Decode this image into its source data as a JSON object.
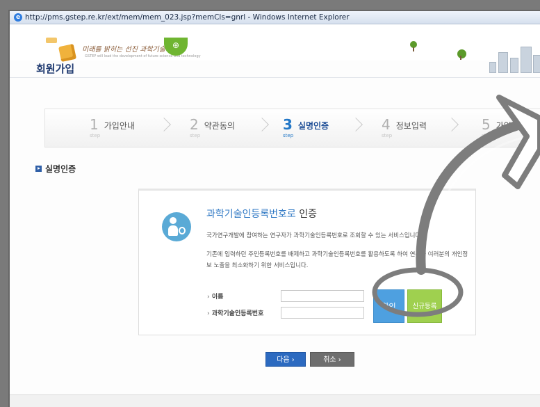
{
  "browser": {
    "title": "http://pms.gstep.re.kr/ext/mem/mem_023.jsp?memCls=gnrl - Windows Internet Explorer"
  },
  "header": {
    "slogan": "미래를 밝히는 선진 과학기술",
    "slogan_en": "GSTEP will lead the development of future science and technology"
  },
  "page": {
    "title": "회원가입"
  },
  "steps": [
    {
      "num": "1",
      "sub": "step",
      "label": "가입안내",
      "active": false
    },
    {
      "num": "2",
      "sub": "step",
      "label": "약관동의",
      "active": false
    },
    {
      "num": "3",
      "sub": "step",
      "label": "실명인증",
      "active": true
    },
    {
      "num": "4",
      "sub": "step",
      "label": "정보입력",
      "active": false
    },
    {
      "num": "5",
      "sub": "step",
      "label": "가입완료",
      "active": false
    }
  ],
  "section": {
    "title": "실명인증"
  },
  "card": {
    "title_highlight": "과학기술인등록번호로",
    "title_suffix": " 인증",
    "desc1": "국가연구개발에 참여하는 연구자가 과학기술인등록번호로 조회할 수 있는 서비스입니다.",
    "desc2": "기존에 입력하던 주민등록번호를 배제하고 과학기술인등록번호를 활용하도록 하여 연구자 여러분의 개인정보 노출을 최소화하기 위한 서비스입니다.",
    "name_label": "이름",
    "regno_label": "과학기술인등록번호",
    "confirm_label": "확인",
    "register_label": "신규등록"
  },
  "buttons": {
    "next": "다음 ›",
    "cancel": "취소 ›"
  },
  "colors": {
    "accent_blue": "#2f78c4",
    "register_green": "#9fd04f",
    "annotation_gray": "#7d7d7d"
  }
}
